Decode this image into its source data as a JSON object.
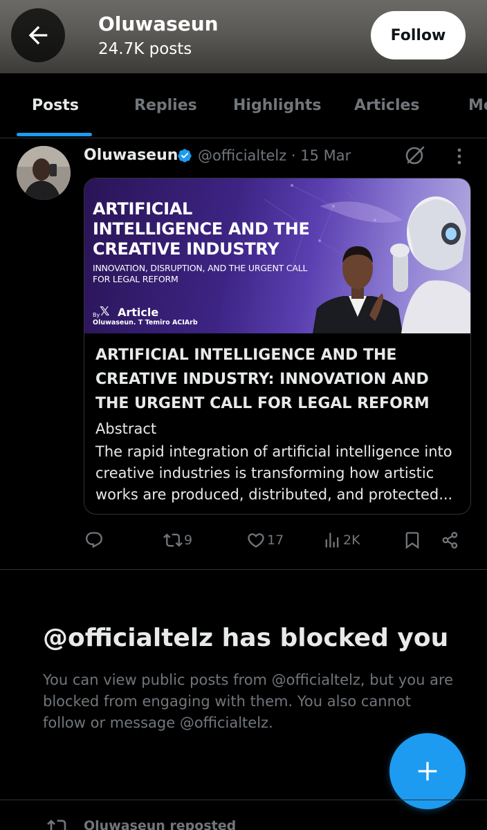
{
  "header": {
    "name": "Oluwaseun",
    "post_count": "24.7K posts",
    "follow_label": "Follow"
  },
  "tabs": [
    {
      "label": "Posts",
      "active": true
    },
    {
      "label": "Replies",
      "active": false
    },
    {
      "label": "Highlights",
      "active": false
    },
    {
      "label": "Articles",
      "active": false
    },
    {
      "label": "Me",
      "active": false
    }
  ],
  "post": {
    "author": "Oluwaseun",
    "handle_date": "@officialtelz · 15 Mar",
    "card": {
      "image": {
        "title_lines": [
          "ARTIFICIAL",
          "INTELLIGENCE AND THE",
          "CREATIVE INDUSTRY"
        ],
        "subtitle_lines": [
          "INNOVATION, DISRUPTION, AND THE URGENT CALL",
          "FOR LEGAL REFORM"
        ],
        "by": "By",
        "x_logo": "𝕏",
        "article_label": "Article",
        "byline": "Oluwaseun. T Temiro ACIArb"
      },
      "title": "ARTIFICIAL INTELLIGENCE AND THE CREATIVE INDUSTRY: INNOVATION AND THE URGENT CALL FOR LEGAL REFORM",
      "abstract_label": "Abstract",
      "body": "The rapid integration of artificial intelligence into creative industries is transforming how artistic works are produced, distributed, and protected..."
    },
    "actions": {
      "replies": "",
      "reposts": "9",
      "likes": "17",
      "views": "2K"
    }
  },
  "blocked": {
    "title": "@officialtelz has blocked you",
    "text": "You can view public posts from @officialtelz, but you are blocked from engaging with them. You also cannot follow or message @officialtelz."
  },
  "next_item": {
    "repost_text": "Oluwaseun reposted"
  },
  "colors": {
    "accent": "#1d9bf0",
    "background": "#000000",
    "muted": "#71767b",
    "border": "#2f3336"
  }
}
